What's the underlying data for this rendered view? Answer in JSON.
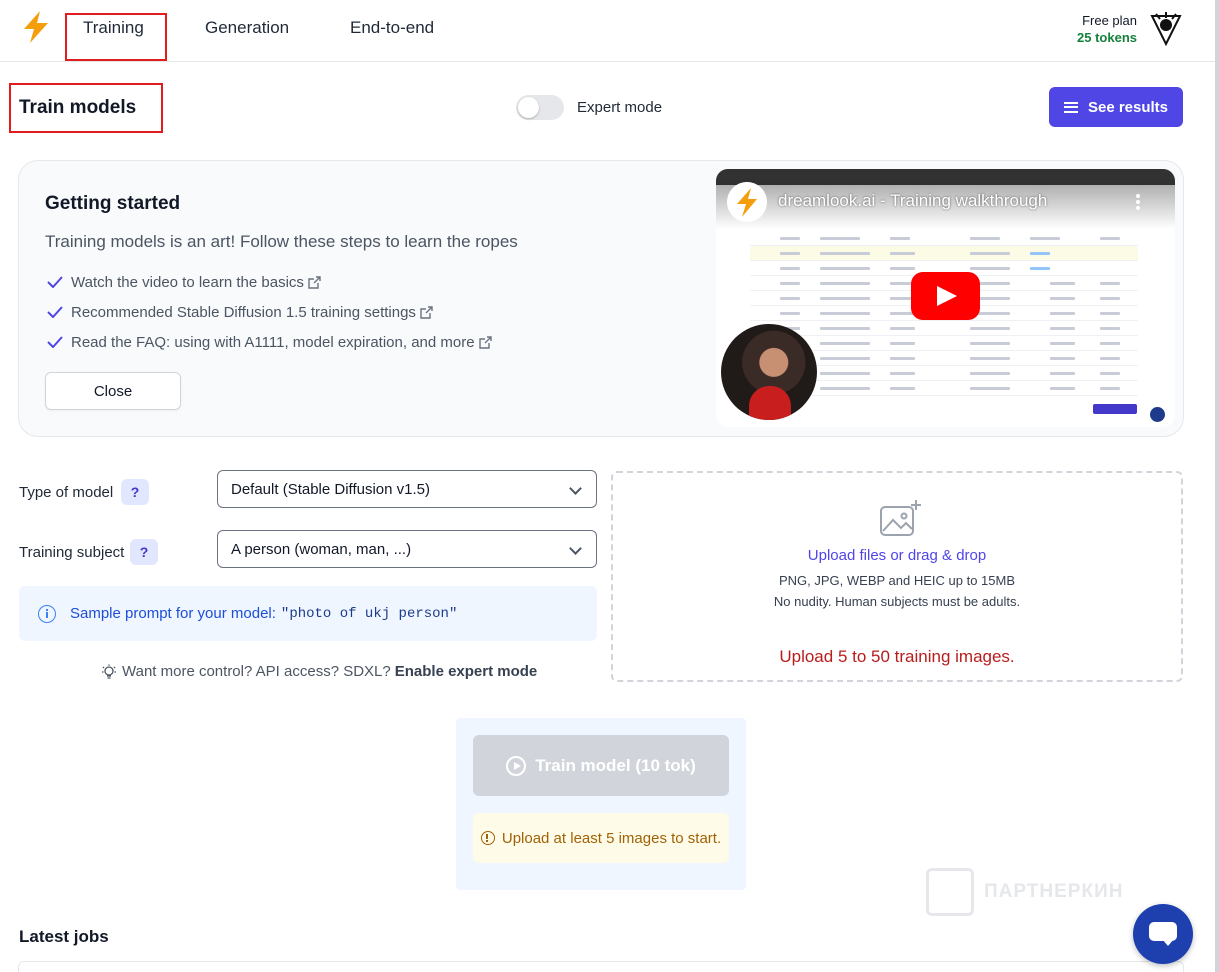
{
  "header": {
    "nav": [
      "Training",
      "Generation",
      "End-to-end"
    ],
    "plan": "Free plan",
    "tokens": "25 tokens"
  },
  "title_row": {
    "title": "Train models",
    "toggle_label": "Expert mode",
    "expert_mode_on": false,
    "see_results": "See results"
  },
  "getting_started": {
    "title": "Getting started",
    "intro": "Training models is an art! Follow these steps to learn the ropes",
    "items": [
      "Watch the video to learn the basics",
      "Recommended Stable Diffusion 1.5 training settings",
      "Read the FAQ: using with A1111, model expiration, and more"
    ],
    "close": "Close",
    "video_title": "dreamlook.ai - Training walkthrough"
  },
  "form": {
    "type_label": "Type of model",
    "type_value": "Default (Stable Diffusion v1.5)",
    "subject_label": "Training subject",
    "subject_value": "A person (woman, man, ...)",
    "help": "?",
    "sample_text": "Sample prompt for your model:",
    "sample_prompt": "\"photo of ukj person\"",
    "expert_hint": "Want more control? API access? SDXL?",
    "expert_link": "Enable expert mode"
  },
  "upload": {
    "link": "Upload files or drag & drop",
    "formats": "PNG, JPG, WEBP and HEIC up to 15MB",
    "rules": "No nudity. Human subjects must be adults.",
    "warning": "Upload 5 to 50 training images."
  },
  "train": {
    "button": "Train model (10 tok)",
    "notice": "Upload at least 5 images to start."
  },
  "latest_jobs": "Latest jobs",
  "watermark": "ПАРТНЕРКИН",
  "colors": {
    "accent": "#4f46e5",
    "highlight_box": "#e11d1d",
    "warning": "#b91c1c"
  }
}
